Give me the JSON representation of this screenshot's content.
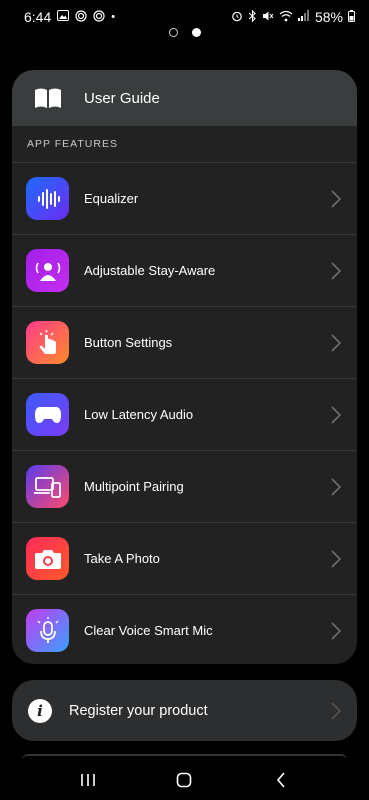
{
  "status_bar": {
    "time": "6:44",
    "battery": "58%"
  },
  "header": {
    "user_guide_label": "User Guide"
  },
  "section": {
    "app_features_label": "APP FEATURES"
  },
  "features": [
    {
      "label": "Equalizer",
      "icon": "equalizer-icon",
      "color_from": "#1e6bff",
      "color_to": "#6b2cf0"
    },
    {
      "label": "Adjustable Stay-Aware",
      "icon": "stay-aware-icon",
      "color_from": "#a21ee8",
      "color_to": "#c42ff0"
    },
    {
      "label": "Button Settings",
      "icon": "button-touch-icon",
      "color_from": "#ff3c8a",
      "color_to": "#ff8a2a"
    },
    {
      "label": "Low Latency Audio",
      "icon": "gamepad-icon",
      "color_from": "#3b5cff",
      "color_to": "#7b3cf5"
    },
    {
      "label": "Multipoint Pairing",
      "icon": "multipoint-devices-icon",
      "color_from": "#5a3cf0",
      "color_to": "#ff4a6a"
    },
    {
      "label": "Take A Photo",
      "icon": "camera-icon",
      "color_from": "#ff2a5a",
      "color_to": "#ff5a2a"
    },
    {
      "label": "Clear Voice Smart Mic",
      "icon": "microphone-icon",
      "color_from": "#c13cf0",
      "color_to": "#3aa0ff"
    }
  ],
  "register": {
    "label": "Register your product"
  }
}
